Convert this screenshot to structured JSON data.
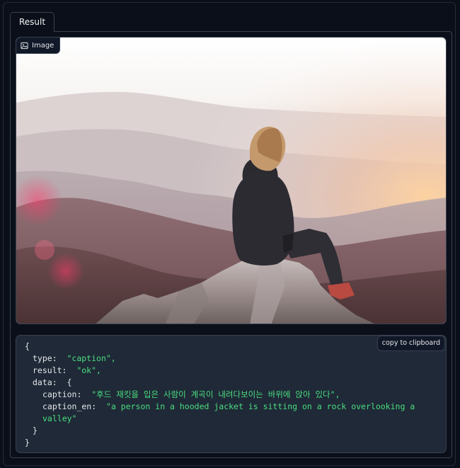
{
  "tab": {
    "label": "Result"
  },
  "image_panel": {
    "label": "Image",
    "icon": "image-icon",
    "description_icon": "image"
  },
  "copy_button": {
    "label": "copy to clipboard"
  },
  "json_view": {
    "open_brace": "{",
    "close_brace": "}",
    "type_key": "type:",
    "type_value": "\"caption\",",
    "result_key": "result:",
    "result_value": "\"ok\",",
    "data_key": "data:",
    "data_open": "{",
    "caption_key": "caption:",
    "caption_value": "\"후드 재킷을 입은 사람이 계곡이 내려다보이는 바위에 앉아 있다\",",
    "caption_en_key": "caption_en:",
    "caption_en_value_line1": "\"a person in a hooded jacket is sitting on a rock overlooking a",
    "caption_en_value_line2": "valley\"",
    "data_close": "}"
  },
  "colors": {
    "background": "#0b0f19",
    "code_background": "#1f2937",
    "string": "#4ade80",
    "border": "#374151"
  }
}
